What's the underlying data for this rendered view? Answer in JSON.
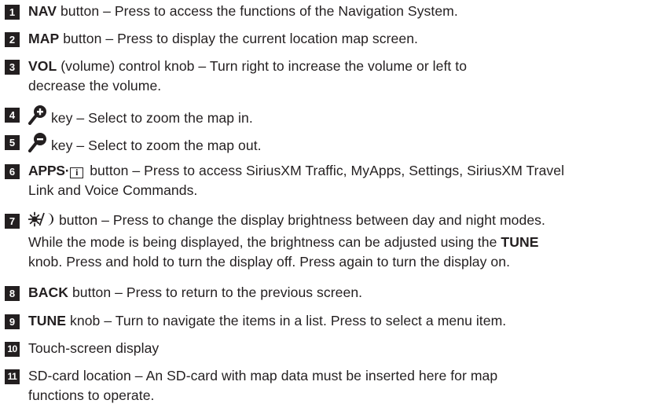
{
  "items": [
    {
      "num": "1",
      "keyword": "NAV",
      "text": " button – Press to access the functions of the Navigation System."
    },
    {
      "num": "2",
      "keyword": "MAP",
      "text": " button – Press to display the current location map screen."
    },
    {
      "num": "3",
      "keyword": "VOL",
      "text": " (volume) control knob – Turn right to increase the volume or left to",
      "line2": "decrease the volume."
    },
    {
      "num": "4",
      "icon": "zoom-in-icon",
      "text": " key – Select to zoom the map in."
    },
    {
      "num": "5",
      "icon": "zoom-out-icon",
      "text": " key – Select to zoom the map out."
    },
    {
      "num": "6",
      "keyword": "APPS·",
      "icon": "info-icon",
      "info_glyph": "i",
      "text": " button – Press to access SiriusXM Traffic, MyApps, Settings, SiriusXM Travel",
      "line2": "Link and Voice Commands."
    },
    {
      "num": "7",
      "icon": "day-night-icon",
      "text": " button – Press to change the display brightness between day and night modes.",
      "line2_pre": "While the mode is being displayed, the brightness can be adjusted using the ",
      "line2_kw": "TUNE",
      "line3": "knob. Press and hold to turn the display off. Press again to turn the display on."
    },
    {
      "num": "8",
      "keyword": "BACK",
      "text": " button – Press to return to the previous screen."
    },
    {
      "num": "9",
      "keyword": "TUNE",
      "text": " knob – Turn to navigate the items in a list. Press to select a menu item."
    },
    {
      "num": "10",
      "text": "Touch-screen display"
    },
    {
      "num": "11",
      "text": "SD-card location – An SD-card with map data must be inserted here for map",
      "line2": "functions to operate."
    }
  ],
  "colors": {
    "text": "#231f20",
    "badge_bg": "#231f20",
    "badge_fg": "#ffffff"
  }
}
